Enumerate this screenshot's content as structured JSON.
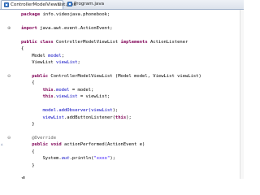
{
  "tabs": [
    {
      "label": "ControllerModelViewList.java",
      "close": "✕",
      "active": true
    },
    {
      "label": "Program.java",
      "close": "",
      "active": false
    }
  ],
  "fold_icons": {
    "expanded": "⊖",
    "collapsed": "⊕"
  },
  "markers": {
    "override": "▵"
  },
  "code": {
    "l1": {
      "kw": "package",
      "rest": " info.videojava.phonebook;"
    },
    "l3": {
      "kw": "import",
      "rest": " java.awt.event.ActionEvent;"
    },
    "l5": {
      "kw1": "public",
      "kw2": "class",
      "t1": " ControllerModelViewList ",
      "kw3": "implements",
      "t2": " ActionListener"
    },
    "l6": {
      "t": "{"
    },
    "l7": {
      "pre": "    Model ",
      "fld": "model",
      "post": ";"
    },
    "l8": {
      "pre": "    ViewList ",
      "fld": "viewList",
      "post": ";"
    },
    "l10": {
      "kw": "public",
      "rest": " ControllerModelViewList (Model model, ViewList viewList)"
    },
    "l11": {
      "t": "    {"
    },
    "l12": {
      "kw": "this",
      "dot": ".",
      "fld": "model",
      "rest": " = model;"
    },
    "l13": {
      "kw": "this",
      "dot": ".",
      "fld": "viewList",
      "rest": " = viewList;"
    },
    "l15": {
      "pre": "model.addObserver(",
      "kw": "viewList",
      "post": ");"
    },
    "l16": {
      "fld": "viewList",
      "mid": ".addButtonListener(",
      "kw": "this",
      "post": ");"
    },
    "l17": {
      "t": "    }"
    },
    "l19": {
      "ann": "@Override"
    },
    "l20": {
      "kw1": "public",
      "kw2": "void",
      "rest": " actionPerformed(ActionEvent e)"
    },
    "l21": {
      "t": "    {"
    },
    "l22": {
      "pre": "System.",
      "fld": "out",
      "mid": ".println(",
      "str": "\"xxxx\"",
      "post": ");"
    },
    "l23": {
      "t": "    }"
    },
    "l25": {
      "t": "}"
    }
  }
}
